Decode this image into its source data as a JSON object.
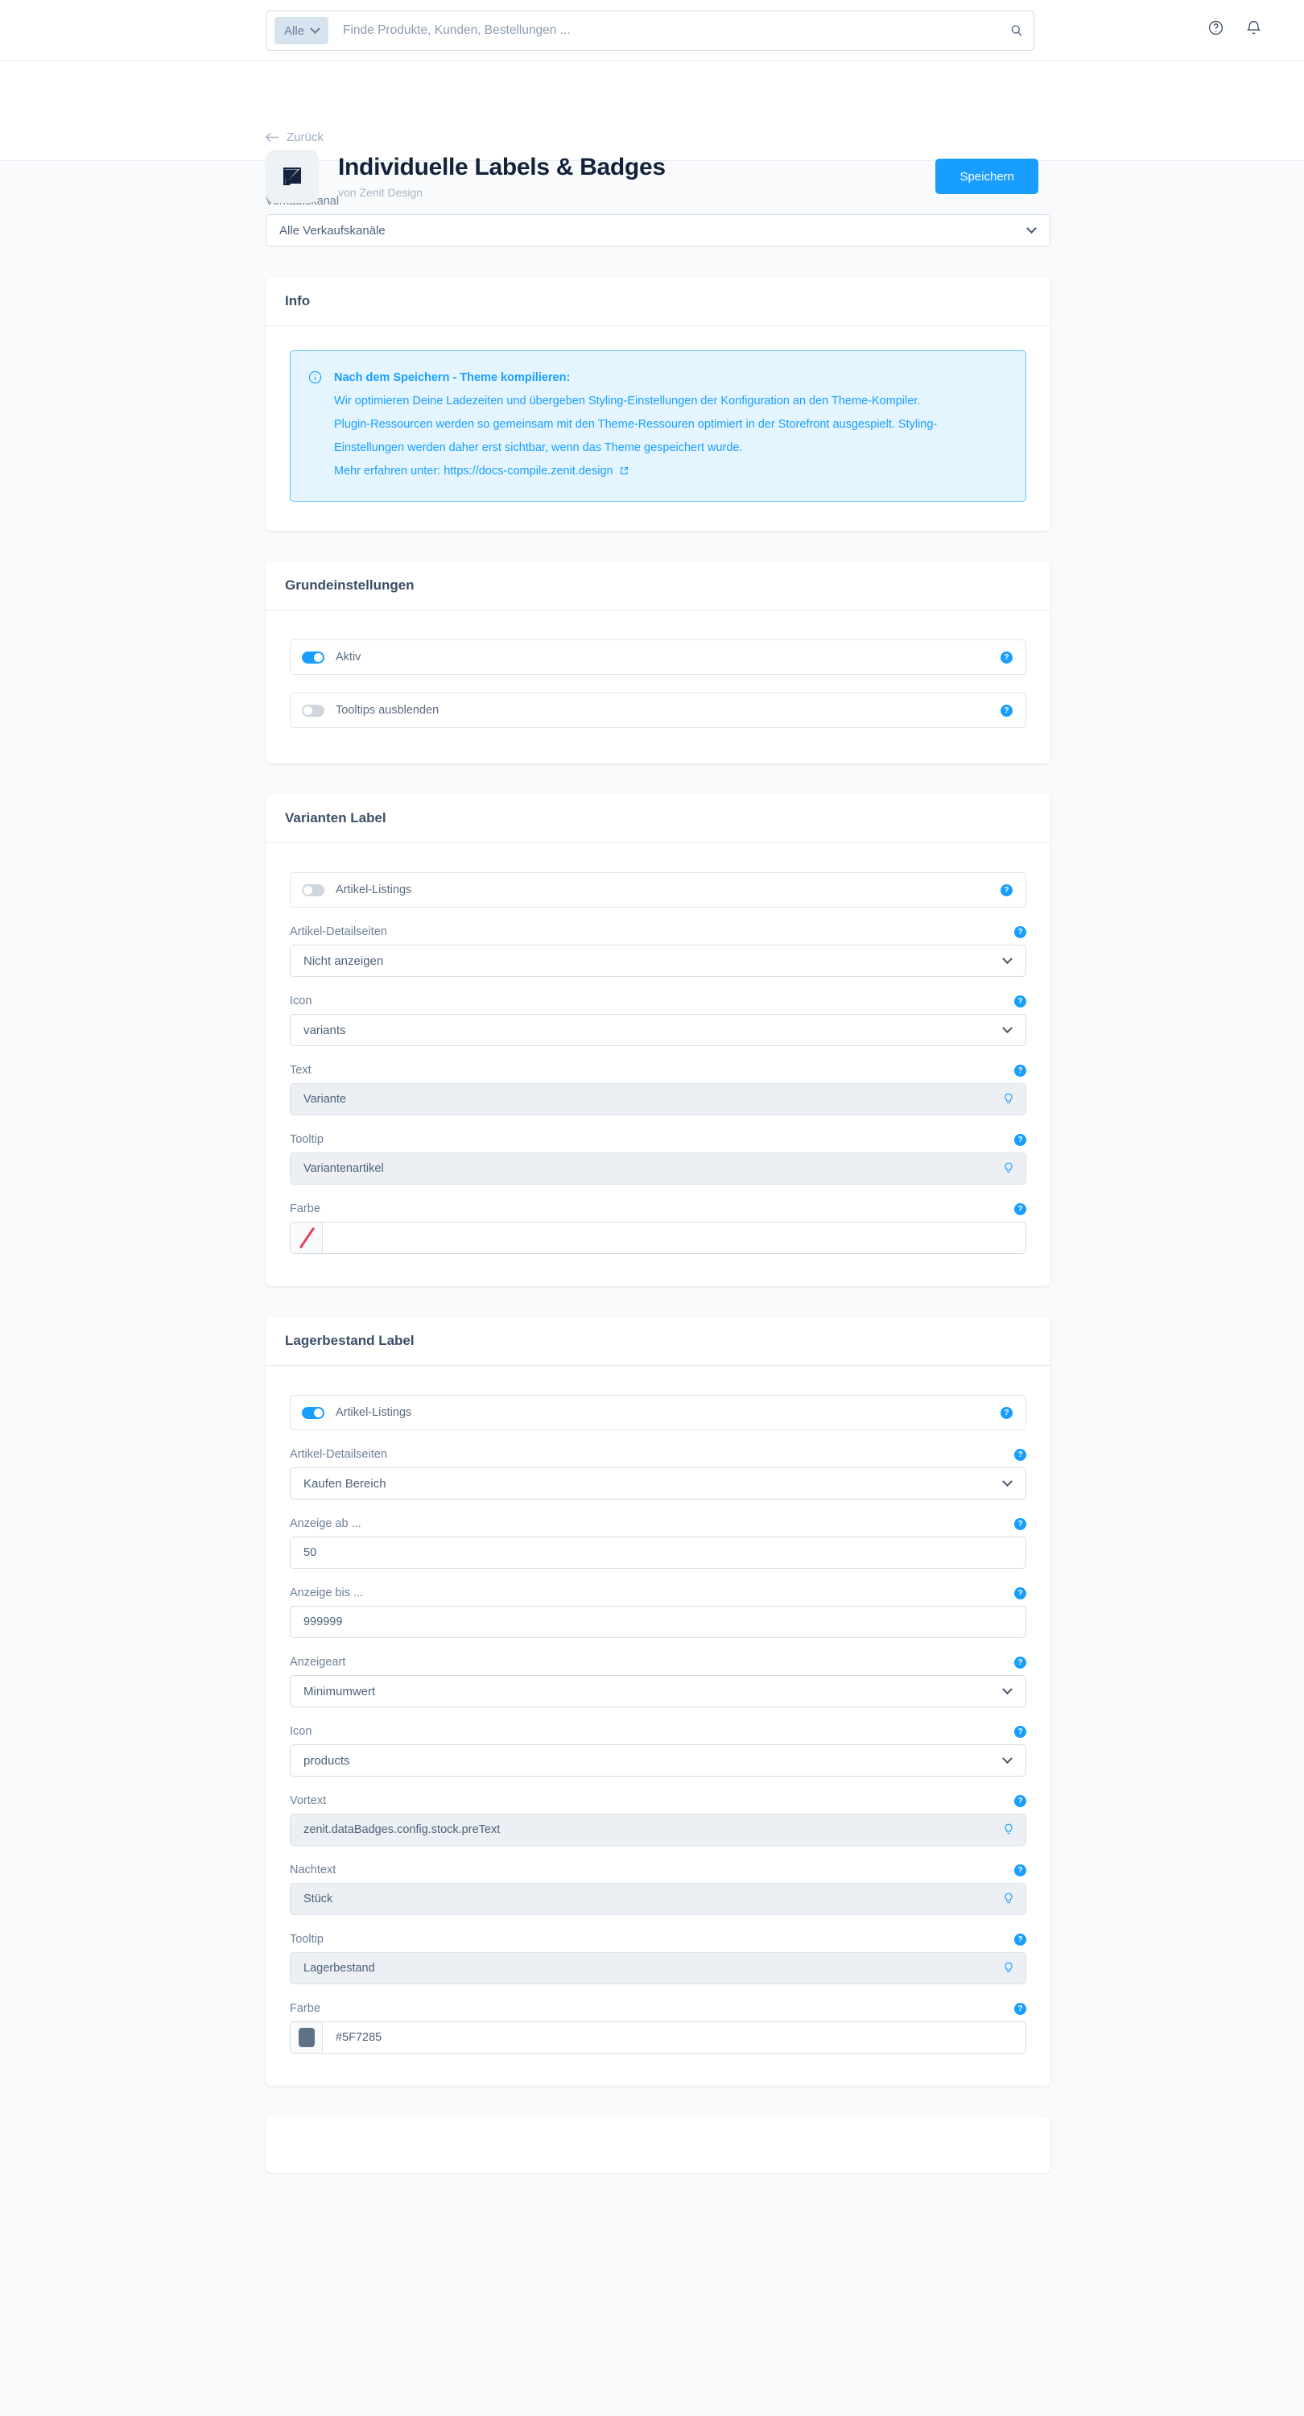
{
  "topbar": {
    "scope_label": "Alle",
    "search_placeholder": "Finde Produkte, Kunden, Bestellungen ...",
    "search_value": "",
    "help_icon": "help-circle-icon",
    "bell_icon": "bell-icon",
    "search_icon": "search-icon"
  },
  "header": {
    "back_label": "Zurück",
    "title": "Individuelle Labels & Badges",
    "subtitle": "von Zenit Design",
    "save_label": "Speichern"
  },
  "saleschannel": {
    "label": "Verkaufskanal",
    "value": "Alle Verkaufskanäle"
  },
  "info_card": {
    "title": "Info",
    "alert": {
      "heading": "Nach dem Speichern - Theme kompilieren:",
      "line1": "Wir optimieren Deine Ladezeiten und übergeben Styling-Einstellungen der Konfiguration an den Theme-Kompiler.",
      "line2": "Plugin-Ressourcen werden so gemeinsam mit den Theme-Ressouren optimiert in der Storefront ausgespielt. Styling-",
      "line3": "Einstellungen werden daher erst sichtbar, wenn das Theme gespeichert wurde.",
      "link_prefix": "Mehr erfahren unter: ",
      "link_text": "https://docs-compile.zenit.design"
    }
  },
  "basic_card": {
    "title": "Grundeinstellungen",
    "toggles": [
      {
        "label": "Aktiv",
        "on": true
      },
      {
        "label": "Tooltips ausblenden",
        "on": false
      }
    ]
  },
  "variant_card": {
    "title": "Varianten Label",
    "toggle": {
      "label": "Artikel-Listings",
      "on": false
    },
    "fields": [
      {
        "label": "Artikel-Detailseiten",
        "value": "Nicht anzeigen",
        "type": "select"
      },
      {
        "label": "Icon",
        "value": "variants",
        "type": "select"
      },
      {
        "label": "Text",
        "value": "Variante",
        "type": "snippet"
      },
      {
        "label": "Tooltip",
        "value": "Variantenartikel",
        "type": "snippet"
      },
      {
        "label": "Farbe",
        "value": "",
        "type": "color",
        "swatch": "none"
      }
    ]
  },
  "stock_card": {
    "title": "Lagerbestand Label",
    "toggle": {
      "label": "Artikel-Listings",
      "on": true
    },
    "fields": [
      {
        "label": "Artikel-Detailseiten",
        "value": "Kaufen Bereich",
        "type": "select"
      },
      {
        "label": "Anzeige ab ...",
        "value": "50",
        "type": "text"
      },
      {
        "label": "Anzeige bis ...",
        "value": "999999",
        "type": "text"
      },
      {
        "label": "Anzeigeart",
        "value": "Minimumwert",
        "type": "select"
      },
      {
        "label": "Icon",
        "value": "products",
        "type": "select"
      },
      {
        "label": "Vortext",
        "value": "zenit.dataBadges.config.stock.preText",
        "type": "snippet"
      },
      {
        "label": "Nachtext",
        "value": "Stück",
        "type": "snippet"
      },
      {
        "label": "Tooltip",
        "value": "Lagerbestand",
        "type": "snippet"
      },
      {
        "label": "Farbe",
        "value": "#5F7285",
        "type": "color",
        "swatch": "#5F7285"
      }
    ]
  },
  "colors": {
    "accent": "#189eff",
    "page_bg": "#f9fafb",
    "title": "#13213a",
    "swatch_stock": "#5F7285"
  }
}
